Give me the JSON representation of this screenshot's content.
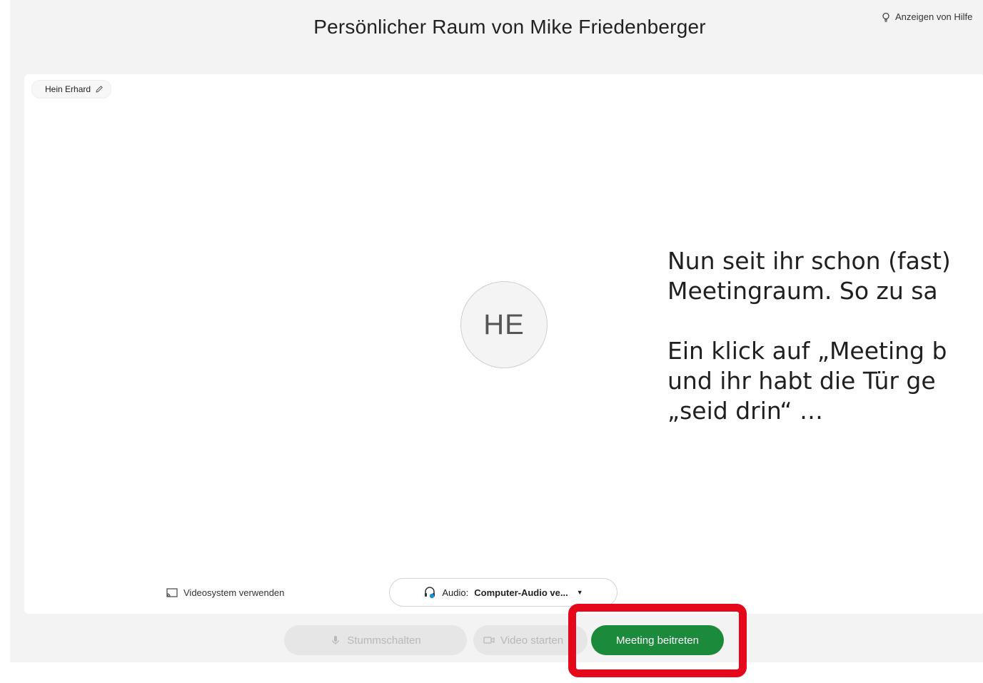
{
  "header": {
    "title": "Persönlicher Raum von Mike Friedenberger",
    "help_label": "Anzeigen von Hilfe"
  },
  "preview": {
    "participant_name": "Hein Erhard",
    "avatar_initials": "HE",
    "video_system_label": "Videosystem verwenden",
    "audio_prefix": "Audio:",
    "audio_value": "Computer-Audio ve..."
  },
  "controls": {
    "mute_label": "Stummschalten",
    "video_label": "Video starten",
    "join_label": "Meeting beitreten"
  },
  "annotation": {
    "line1": "Nun seit ihr schon (fast)",
    "line2": "Meetingraum. So zu sa",
    "line3": "Ein klick auf „Meeting b",
    "line4": "und ihr habt die Tür ge",
    "line5": "„seid drin“ …"
  },
  "colors": {
    "join_button": "#1b8a3a",
    "highlight": "#e5081b",
    "background": "#f3f3f3"
  }
}
